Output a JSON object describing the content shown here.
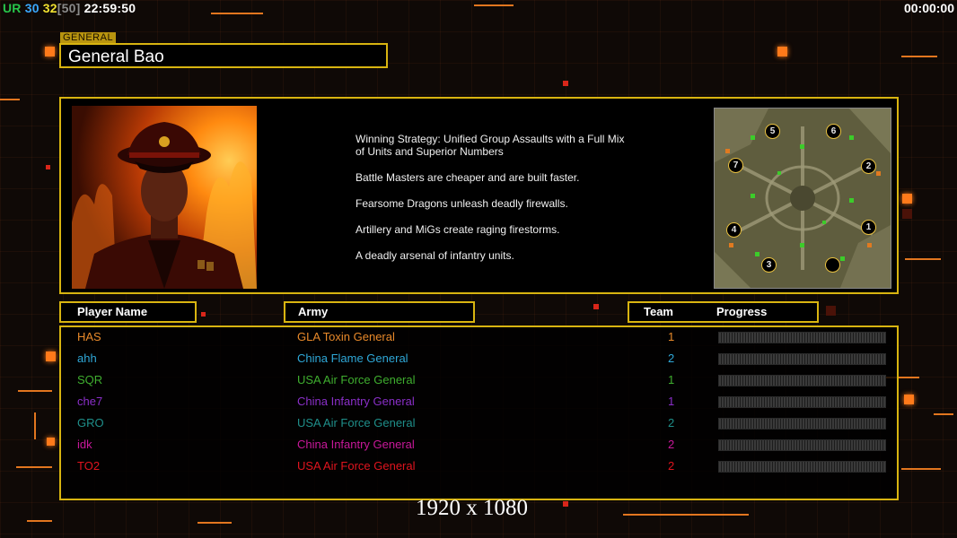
{
  "hud": {
    "ur_label": "UR",
    "ur_value": "30",
    "fps_value": "32",
    "fps_max": "[50]",
    "clock": "22:59:50",
    "timer": "00:00:00"
  },
  "general": {
    "label": "GENERAL",
    "name": "General Bao"
  },
  "strategy_lines": [
    "Winning Strategy: Unified Group Assaults with a Full Mix of Units and Superior Numbers",
    "Battle Masters are cheaper and are built faster.",
    "Fearsome Dragons unleash deadly firewalls.",
    "Artillery and MiGs create raging firestorms.",
    "A deadly arsenal of infantry units."
  ],
  "map": {
    "start_positions": [
      "1",
      "2",
      "3",
      "4",
      "5",
      "6",
      "7"
    ]
  },
  "columns": {
    "player_name": "Player Name",
    "army": "Army",
    "team": "Team",
    "progress": "Progress"
  },
  "players": [
    {
      "name": "HAS",
      "army": "GLA Toxin General",
      "team": "1",
      "color": "#e8892a"
    },
    {
      "name": "ahh",
      "army": "China Flame General",
      "team": "2",
      "color": "#2fa8d8"
    },
    {
      "name": "SQR",
      "army": "USA Air Force General",
      "team": "1",
      "color": "#3fae2f"
    },
    {
      "name": "che7",
      "army": "China Infantry General",
      "team": "1",
      "color": "#8a2fc8"
    },
    {
      "name": "GRO",
      "army": "USA Air Force General",
      "team": "2",
      "color": "#1f8f8a"
    },
    {
      "name": "idk",
      "army": "China Infantry General",
      "team": "2",
      "color": "#c8189a"
    },
    {
      "name": "TO2",
      "army": "USA Air Force General",
      "team": "2",
      "color": "#e0141e"
    }
  ],
  "resolution": "1920 x 1080",
  "colors": {
    "frame": "#d8b410",
    "accent": "#ff7a1a"
  }
}
